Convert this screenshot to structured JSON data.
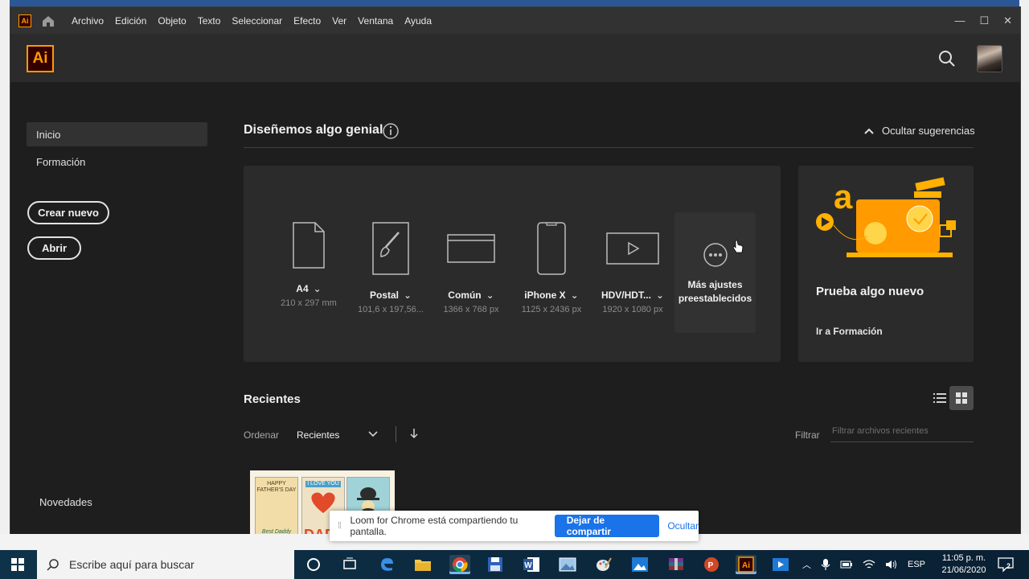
{
  "app": {
    "badge": "Ai",
    "menu": [
      "Archivo",
      "Edición",
      "Objeto",
      "Texto",
      "Seleccionar",
      "Efecto",
      "Ver",
      "Ventana",
      "Ayuda"
    ],
    "window_controls": [
      "—",
      "☐",
      "✕"
    ]
  },
  "sidebar": {
    "items": [
      {
        "label": "Inicio",
        "active": true
      },
      {
        "label": "Formación",
        "active": false
      }
    ],
    "create_new": "Crear nuevo",
    "open": "Abrir",
    "news": "Novedades"
  },
  "main": {
    "title": "Diseñemos algo genial",
    "hide_suggestions": "Ocultar sugerencias",
    "presets": [
      {
        "name": "A4",
        "size": "210 x 297 mm",
        "icon": "document-icon"
      },
      {
        "name": "Postal",
        "size": "101,6 x 197,56...",
        "icon": "brush-icon"
      },
      {
        "name": "Común",
        "size": "1366 x 768 px",
        "icon": "browser-window-icon"
      },
      {
        "name": "iPhone X",
        "size": "1125 x 2436 px",
        "icon": "phone-icon"
      },
      {
        "name": "HDV/HDT...",
        "size": "1920 x 1080 px",
        "icon": "video-play-icon"
      }
    ],
    "more_presets": "Más ajustes preestablecidos",
    "try_new": {
      "title": "Prueba algo nuevo",
      "link": "Ir a Formación"
    },
    "recents": {
      "title": "Recientes",
      "sort_label": "Ordenar",
      "sort_value": "Recientes",
      "filter_label": "Filtrar",
      "filter_placeholder": "Filtrar archivos recientes",
      "thumbnail_cards": [
        "HAPPY FATHER'S DAY",
        "Best Daddy",
        "I LOVE YOU",
        "DAD"
      ]
    }
  },
  "loom": {
    "message": "Loom for Chrome está compartiendo tu pantalla.",
    "stop": "Dejar de compartir",
    "hide": "Ocultar"
  },
  "taskbar": {
    "search_placeholder": "Escribe aquí para buscar",
    "language": "ESP",
    "time": "11:05 p. m.",
    "date": "21/06/2020",
    "notifications": "2",
    "apps": [
      "cortana",
      "task-view",
      "edge",
      "file-explorer",
      "chrome",
      "save",
      "word",
      "photos",
      "paint",
      "store",
      "winrar",
      "powerpoint",
      "illustrator",
      "media"
    ]
  },
  "colors": {
    "accent": "#ff9a00",
    "panel": "#2b2b2b",
    "background": "#1e1e1e",
    "loom_button": "#1a73e8"
  }
}
